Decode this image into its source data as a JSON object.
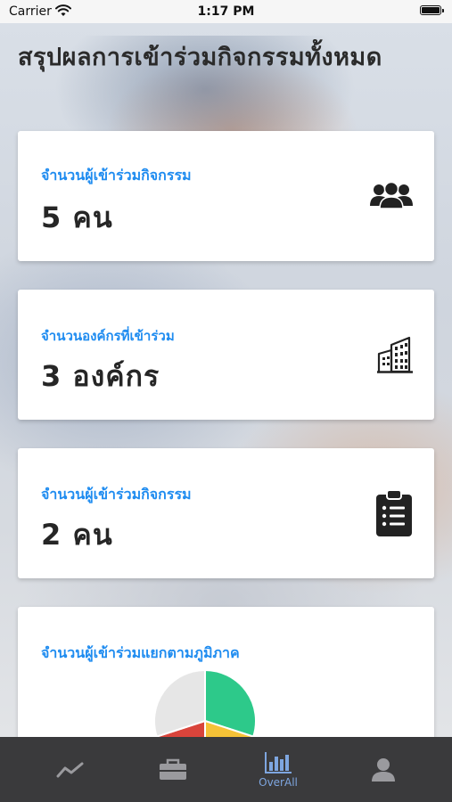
{
  "status_bar": {
    "carrier": "Carrier",
    "time": "1:17 PM"
  },
  "page": {
    "title": "สรุปผลการเข้าร่วมกิจกรรมทั้งหมด"
  },
  "cards": [
    {
      "label": "จำนวนผู้เข้าร่วมกิจกรรม",
      "value": "5 คน",
      "icon": "people-group-icon"
    },
    {
      "label": "จำนวนองค์กรที่เข้าร่วม",
      "value": "3 องค์กร",
      "icon": "building-icon"
    },
    {
      "label": "จำนวนผู้เข้าร่วมกิจกรรม",
      "value": "2 คน",
      "icon": "clipboard-list-icon"
    },
    {
      "label": "จำนวนผู้เข้าร่วมแยกตามภูมิภาค",
      "icon": "pie-chart"
    }
  ],
  "chart_data": {
    "type": "pie",
    "title": "",
    "values": [
      30,
      20,
      20,
      30
    ],
    "colors": [
      "#2dc98a",
      "#f5c237",
      "#d9443b",
      "#e6e6e6"
    ]
  },
  "tab_bar": {
    "tabs": [
      {
        "label": "",
        "icon": "line-chart-icon",
        "active": false
      },
      {
        "label": "",
        "icon": "briefcase-icon",
        "active": false
      },
      {
        "label": "OverAll",
        "icon": "bar-chart-icon",
        "active": true
      },
      {
        "label": "",
        "icon": "user-icon",
        "active": false
      }
    ]
  }
}
